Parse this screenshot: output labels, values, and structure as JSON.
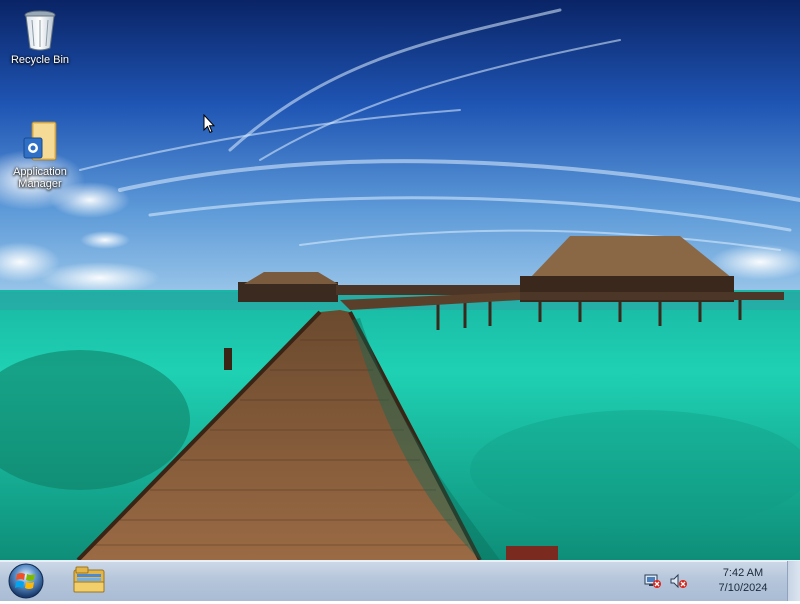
{
  "desktop": {
    "icons": [
      {
        "label": "Recycle Bin",
        "icon": "recycle-bin-icon"
      },
      {
        "label": "Application\nManager",
        "icon": "application-manager-icon"
      }
    ]
  },
  "taskbar": {
    "start_icon": "windows-orb-icon",
    "pinned": [
      {
        "icon": "file-explorer-icon"
      }
    ],
    "tray": {
      "icons": [
        "network-disconnected-icon",
        "volume-muted-icon"
      ],
      "time": "7:42 AM",
      "date": "7/10/2024"
    }
  },
  "colors": {
    "taskbar": "#b6c6db",
    "sky_top": "#0b2a6e",
    "water": "#1fcfb0"
  }
}
